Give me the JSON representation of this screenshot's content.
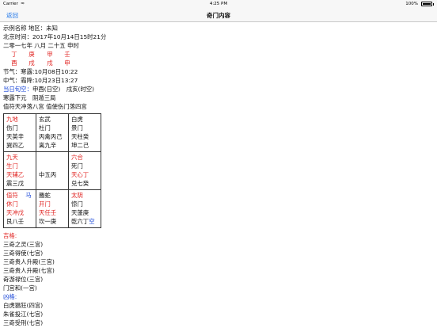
{
  "status": {
    "carrier": "Carrier",
    "time": "4:25 PM",
    "battery": "100%"
  },
  "nav": {
    "back": "返回",
    "title": "奇门内容"
  },
  "info": {
    "example": "示例名称 地区：未知",
    "beijing_time": "北京时间：2017年10月14日15时21分",
    "lunar": "二零一七年 八月 二十五 申时",
    "stems": [
      "丁",
      "庚",
      "甲",
      "壬"
    ],
    "branches": [
      "酉",
      "戌",
      "戌",
      "申"
    ],
    "jieqi": "节气：寒露:10月08日10:22",
    "zhongqi": "中气：霜降:10月23日13:27",
    "xunkong_label": "当日旬空：",
    "xunkong_value": "申酉(日空)　戌亥(时空)",
    "ju": "寒露下元　阴遁三局",
    "zhifu": "值符天冲落八宫 值使伤门落四宫"
  },
  "palaces": [
    {
      "lines": [
        "九地",
        "伤门",
        "天英辛",
        "巽四乙"
      ]
    },
    {
      "lines": [
        "玄武",
        "杜门",
        "丙禽丙己",
        "离九辛"
      ]
    },
    {
      "lines": [
        "白虎",
        "景门",
        "天柱癸",
        "坤二己"
      ]
    },
    {
      "lines": [
        "九天",
        "生门",
        "天辅乙",
        "震三戊"
      ]
    },
    {
      "lines": [
        "中五丙"
      ]
    },
    {
      "lines": [
        "六合",
        "死门",
        "天心丁",
        "兑七癸"
      ]
    },
    {
      "lines": [
        "值符",
        "马",
        "休门",
        "天冲戊",
        "艮八壬"
      ]
    },
    {
      "lines": [
        "螣蛇",
        "开门",
        "天任壬",
        "坎一庚"
      ]
    },
    {
      "lines": [
        "太阴",
        "惊门",
        "天蓬庚",
        "乾六丁",
        "空"
      ]
    }
  ],
  "ji": {
    "label": "吉格:",
    "items": [
      "三奇之灵(三宫)",
      "三奇得使(七宫)",
      "三奇贵人升殿(三宫)",
      "三奇贵人升殿(七宫)",
      "奇游禄位(三宫)",
      "门宫和(一宫)"
    ]
  },
  "xiong": {
    "label": "凶格:",
    "items": [
      "白虎猖狂(四宫)",
      "朱雀投江(七宫)",
      "三奇受刑(七宫)"
    ]
  },
  "colors": {
    "red": "#e0201e",
    "blue": "#1a47d8",
    "link": "#1a73e8"
  }
}
